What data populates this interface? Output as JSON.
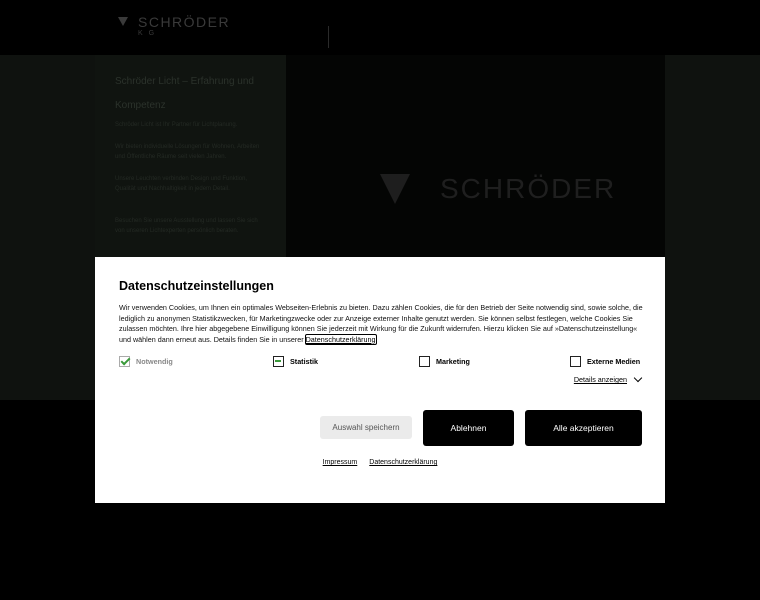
{
  "header": {
    "logo_text": "SCHRÖDER",
    "logo_subtext": "KG"
  },
  "hero": {
    "panel_title": "Schröder Licht – Erfahrung und Kompetenz",
    "panel_paragraphs": [
      "Schröder Licht ist Ihr Partner für Lichtplanung.",
      "Wir bieten individuelle Lösungen für Wohnen, Arbeiten und Öffentliche Räume seit vielen Jahren.",
      "Unsere Leuchten verbinden Design und Funktion, Qualität und Nachhaltigkeit in jedem Detail.",
      "Besuchen Sie unsere Ausstellung und lassen Sie sich von unseren Lichtexperten persönlich beraten."
    ],
    "logo_text": "SCHRÖDER"
  },
  "cookie": {
    "title": "Datenschutzeinstellungen",
    "body_text": "Wir verwenden Cookies, um Ihnen ein optimales Webseiten-Erlebnis zu bieten. Dazu zählen Cookies, die für den Betrieb der Seite notwendig sind, sowie solche, die lediglich zu anonymen Statistikzwecken, für Marketingzwecke oder zur Anzeige externer Inhalte genutzt werden. Sie können selbst festlegen, welche Cookies Sie zulassen möchten. Ihre hier abgegebene Einwilligung können Sie jederzeit mit Wirkung für die Zukunft widerrufen. Hierzu klicken Sie auf »Datenschutzeinstellung« und wählen dann erneut aus. Details finden Sie in unserer ",
    "body_link": "Datenschutzerklärung",
    "options": {
      "necessary": "Notwendig",
      "statistics": "Statistik",
      "marketing": "Marketing",
      "external": "Externe Medien"
    },
    "details_label": "Details anzeigen",
    "buttons": {
      "save": "Auswahl speichern",
      "reject": "Ablehnen",
      "accept": "Alle akzeptieren"
    },
    "footer": {
      "imprint": "Impressum",
      "privacy": "Datenschutzerklärung"
    },
    "accent_color": "#3a9a3a"
  }
}
